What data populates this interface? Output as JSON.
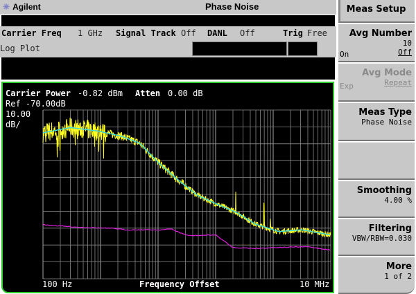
{
  "header": {
    "brand": "Agilent",
    "mode": "Phase Noise"
  },
  "settings": {
    "carrier_freq_label": "Carrier Freq",
    "carrier_freq_value": "1 GHz",
    "signal_track_label": "Signal Track",
    "signal_track_value": "Off",
    "danl_label": "DANL",
    "danl_value": "Off",
    "trig_label": "Trig",
    "trig_value": "Free",
    "view": "Log Plot"
  },
  "plot": {
    "carrier_power_label": "Carrier Power",
    "carrier_power_value": "-0.82 dBm",
    "atten_label": "Atten",
    "atten_value": "0.00 dB",
    "ref": "Ref -70.00dB",
    "scale_value": "10.00",
    "scale_unit": "dB/",
    "x_start": "100 Hz",
    "x_label": "Frequency Offset",
    "x_stop": "10 MHz"
  },
  "softkeys": {
    "menu_title": "Meas Setup",
    "avg_number": {
      "label": "Avg Number",
      "value": "10",
      "opt_on": "On",
      "opt_off": "Off"
    },
    "avg_mode": {
      "label": "Avg Mode",
      "opt_exp": "Exp",
      "opt_repeat": "Repeat"
    },
    "meas_type": {
      "label": "Meas Type",
      "value": "Phase Noise"
    },
    "smoothing": {
      "label": "Smoothing",
      "value": "4.00 %"
    },
    "filtering": {
      "label": "Filtering",
      "value": "VBW/RBW=0.030"
    },
    "more": {
      "label": "More",
      "value": "1 of 2"
    }
  },
  "chart_data": {
    "type": "line",
    "xscale": "log",
    "xlim_hz": [
      100,
      10000000
    ],
    "ylim_db": [
      -170,
      -70
    ],
    "y_divisions": 10,
    "grid": true,
    "series": [
      {
        "name": "smoothed",
        "color": "#3fd8d8",
        "log10_freq": [
          2,
          2.48,
          2.96,
          3.36,
          3.68,
          4.0,
          4.33,
          4.69,
          5.0,
          5.37,
          5.69,
          6.1,
          6.5,
          7
        ],
        "db": [
          -83.5,
          -80.4,
          -82.5,
          -85.5,
          -89.6,
          -101,
          -111,
          -120.7,
          -125.4,
          -130.8,
          -137.6,
          -142,
          -141,
          -144
        ]
      },
      {
        "name": "raw",
        "color": "#ffff20",
        "note_noise": "raw trace follows smoothed with noise"
      },
      {
        "name": "floor",
        "color": "#e020e0",
        "log10_freq": [
          2,
          2.64,
          3.24,
          3.44,
          3.64,
          4.04,
          4.24,
          4.36,
          4.54,
          5.0,
          5.3,
          5.72,
          6.0,
          6.6,
          7
        ],
        "db": [
          -138,
          -139.5,
          -140.2,
          -141,
          -141,
          -141,
          -140.5,
          -142.5,
          -144.5,
          -144,
          -151.5,
          -152,
          -151.5,
          -151,
          -153
        ]
      }
    ]
  }
}
